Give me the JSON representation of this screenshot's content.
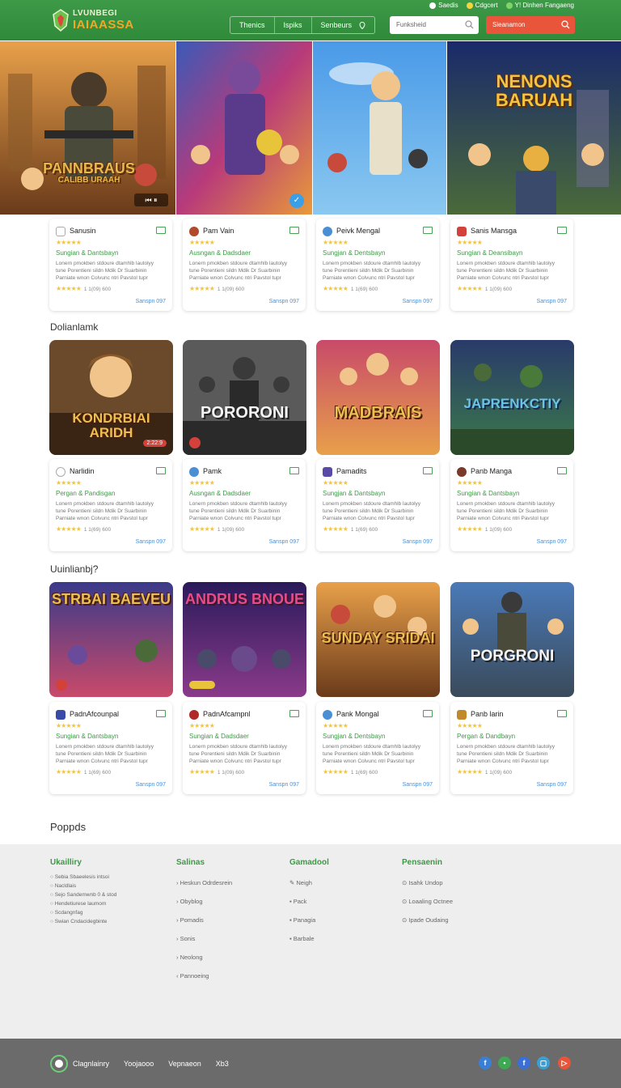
{
  "header": {
    "logo_top": "LVUNBEGI",
    "logo_bottom": "IAIAASSA",
    "top_links": [
      {
        "label": "Saedis",
        "dot": "#ffffff"
      },
      {
        "label": "Cdgcert",
        "dot": "#f5d442"
      },
      {
        "label": "Y! Dinhen Fangaeng",
        "dot": "#7fd36a"
      }
    ],
    "nav": [
      "Thenics",
      "Ispiks",
      "Senbeurs"
    ],
    "search_placeholder": "Funksheid",
    "cta_label": "Sieanamon"
  },
  "hero": [
    {
      "title": "PANNBRAUS",
      "subtitle": "CALIBB URAAH"
    },
    {
      "title": "",
      "subtitle": ""
    },
    {
      "title": "",
      "subtitle": ""
    },
    {
      "title": "NENONS BARUAH",
      "subtitle": ""
    }
  ],
  "cards_row1": [
    {
      "name": "Sanusin",
      "genre": "Sungian & Dantsbayn",
      "meta": "1 1(09) 600",
      "link": "Sanspn 097",
      "icon_color": "#ffffff"
    },
    {
      "name": "Pam Vain",
      "genre": "Ausngan & Dadsdaer",
      "meta": "1 1(09) 600",
      "link": "Sanspn 097",
      "icon_color": "#b04a2a"
    },
    {
      "name": "Peivk Mengal",
      "genre": "Sungjan & Dentsbayn",
      "meta": "1 1(69) 600",
      "link": "Sanspn 097",
      "icon_color": "#4a8fd4"
    },
    {
      "name": "Sanis Mansga",
      "genre": "Sungian & Deansibayn",
      "meta": "1 1(09) 600",
      "link": "Sanspn 097",
      "icon_color": "#d4403a"
    }
  ],
  "section2_title": "Dolianlamk",
  "thumbs_row2": [
    {
      "title": "KONDRBIAI ARIDH",
      "badge": "2:22:9"
    },
    {
      "title": "PORORONI",
      "badge": ""
    },
    {
      "title": "MADBRAIS",
      "badge": ""
    },
    {
      "title": "JAPRENKCTIY",
      "badge": ""
    }
  ],
  "cards_row2": [
    {
      "name": "Narlidin",
      "genre": "Pergan & Pandisgan",
      "meta": "1 1(69) 600",
      "link": "Sanspn 097",
      "icon_color": "#ffffff"
    },
    {
      "name": "Pamk",
      "genre": "Ausngan & Dadsdaer",
      "meta": "1 1(09) 600",
      "link": "Sanspn 097",
      "icon_color": "#4a8fd4"
    },
    {
      "name": "Pamadits",
      "genre": "Sungjan & Dantsbayn",
      "meta": "1 1(69) 600",
      "link": "Sanspn 097",
      "icon_color": "#5a4aa8"
    },
    {
      "name": "Panb Manga",
      "genre": "Sungian & Dantsbayn",
      "meta": "1 1(09) 600",
      "link": "Sanspn 097",
      "icon_color": "#7a3a2a"
    }
  ],
  "section3_title": "Uuinlianbj?",
  "thumbs_row3": [
    {
      "title": "STRBAI BAEVEU",
      "badge": ""
    },
    {
      "title": "ANDRUS BNOUE",
      "badge": "yellow"
    },
    {
      "title": "SUNDAY SRIDAI",
      "badge": ""
    },
    {
      "title": "PORGRONI",
      "badge": ""
    }
  ],
  "cards_row3": [
    {
      "name": "PadnAfcounpal",
      "genre": "Sungian & Dantsbayn",
      "meta": "1 1(69) 600",
      "link": "Sanspn 097",
      "icon_color": "#3a4aa8"
    },
    {
      "name": "PadnAfcampnl",
      "genre": "Sungian & Dadsdaer",
      "meta": "1 1(09) 600",
      "link": "Sanspn 097",
      "icon_color": "#b02a2a"
    },
    {
      "name": "Pank Mongal",
      "genre": "Sungjan & Dentsbayn",
      "meta": "1 1(69) 600",
      "link": "Sanspn 097",
      "icon_color": "#4a8fd4"
    },
    {
      "name": "Panb larin",
      "genre": "Pergan & Dandbayn",
      "meta": "1 1(09) 600",
      "link": "Sanspn 097",
      "icon_color": "#c08a2a"
    }
  ],
  "card_desc": "Lonern pmokben stdoure dtamhlb lautolyy tune Porentieni sildn Mdik Dr Suarbinin Parniate wnon Colvunc ntri Pavstol tupr Fienicte wstto Iirooeling Phaveleing",
  "section4_title": "Poppds",
  "footer": {
    "col1_title": "Ukailliry",
    "col1_items": [
      "Sebia Sbaeelesis intsoi",
      "Nacldlais",
      "Sejo Sandemwnb 0 & stod",
      "Hendetiurese laumom",
      "Scdangnfag",
      "Swian Cndacidegbinte"
    ],
    "col2_title": "Salinas",
    "col2_items": [
      "Heskun Odrdesrein",
      "Obyblog",
      "Pomadis",
      "Sonis",
      "Neolong",
      "Pannoeing"
    ],
    "col3_title": "Gamadool",
    "col3_items": [
      "Neigh",
      "Pack",
      "Panagia",
      "Barbale"
    ],
    "col4_title": "Pensaenin",
    "col4_items": [
      "Isahk Undop",
      "Loaaling Octnee",
      "Ipade Oudaing"
    ]
  },
  "bottom": {
    "links": [
      "Clagnlainry",
      "Yoojaooo",
      "Vepnaeon",
      "Xb3"
    ],
    "social": [
      {
        "glyph": "f",
        "color": "#3b7fd4"
      },
      {
        "glyph": "t",
        "color": "#3fa852"
      },
      {
        "glyph": "f",
        "color": "#3b6fd4"
      },
      {
        "glyph": "in",
        "color": "#3b9fd4"
      },
      {
        "glyph": "yt",
        "color": "#e8553a"
      }
    ]
  },
  "colors": {
    "primary_green": "#3d9a47",
    "accent_orange": "#e8553a",
    "star": "#f2c442",
    "link_blue": "#4a8fd4"
  }
}
